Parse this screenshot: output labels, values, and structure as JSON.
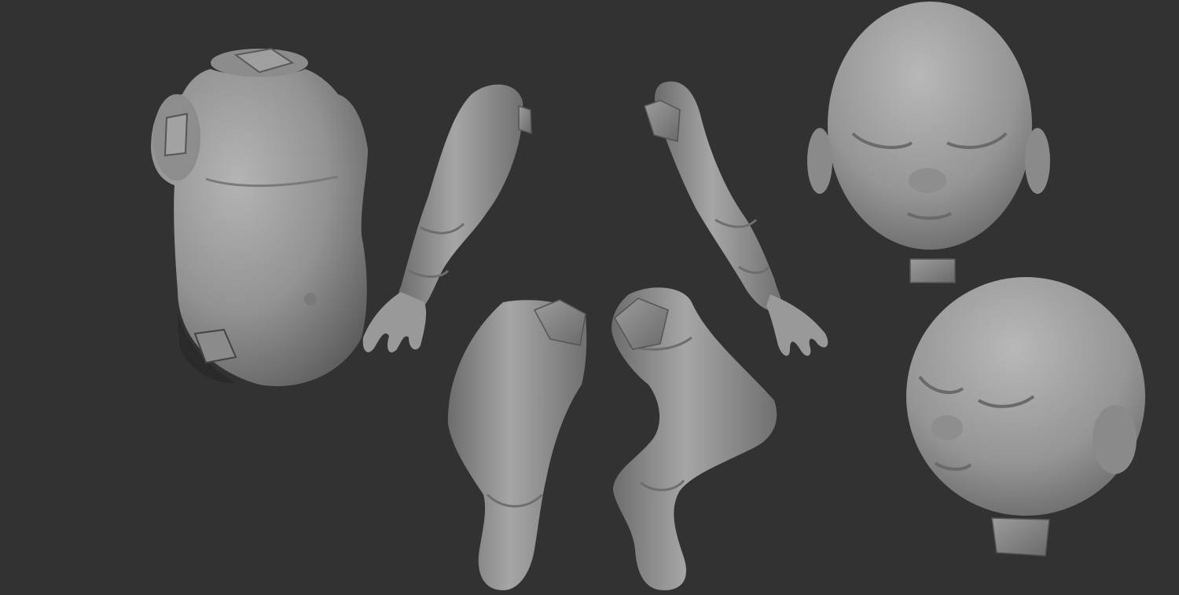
{
  "scene": {
    "background": "#323232",
    "material_light": "#a9a9a9",
    "material_mid": "#8a8a8a",
    "material_dark": "#5c5c5c",
    "socket_dark": "#1e1e1e",
    "parts": [
      {
        "name": "torso"
      },
      {
        "name": "left-arm"
      },
      {
        "name": "right-arm"
      },
      {
        "name": "left-leg"
      },
      {
        "name": "right-leg"
      },
      {
        "name": "head-front"
      },
      {
        "name": "head-three-quarter"
      }
    ]
  }
}
